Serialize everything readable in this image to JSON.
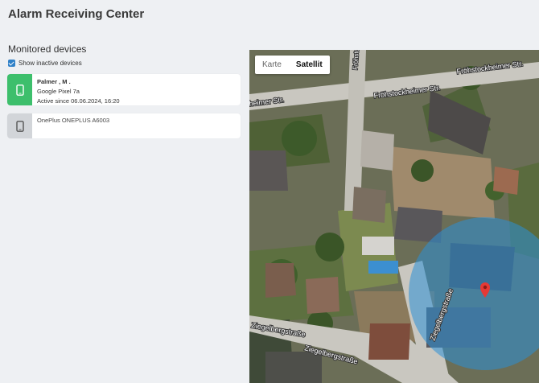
{
  "app": {
    "title": "Alarm Receiving Center"
  },
  "section": {
    "title": "Monitored devices"
  },
  "filter": {
    "show_inactive_label": "Show inactive devices",
    "show_inactive_checked": true
  },
  "devices": [
    {
      "name": "Palmer , M .",
      "model": "Google Pixel 7a",
      "status_text": "Active since 06.06.2024, 16:20",
      "status": "active",
      "status_color": "#3dbf6c",
      "icon": "phone-icon"
    },
    {
      "model": "OnePlus ONEPLUS A6003",
      "status": "inactive",
      "status_color": "#d2d5d9",
      "icon": "phone-icon"
    }
  ],
  "map": {
    "type_options": [
      "Karte",
      "Satellit"
    ],
    "selected_type": "Satellit",
    "street_labels": [
      "Fröhstockheimer Str.",
      "Fröhstockheimer Str.",
      "heimer Str.",
      "Ziegelbergstraße",
      "Ziegelbergstraße",
      "Ziegelbergstraße",
      "Fröhstockheimer Str."
    ],
    "marker_icon": "location-pin-icon",
    "accuracy_circle_color": "#2b8fd6"
  }
}
